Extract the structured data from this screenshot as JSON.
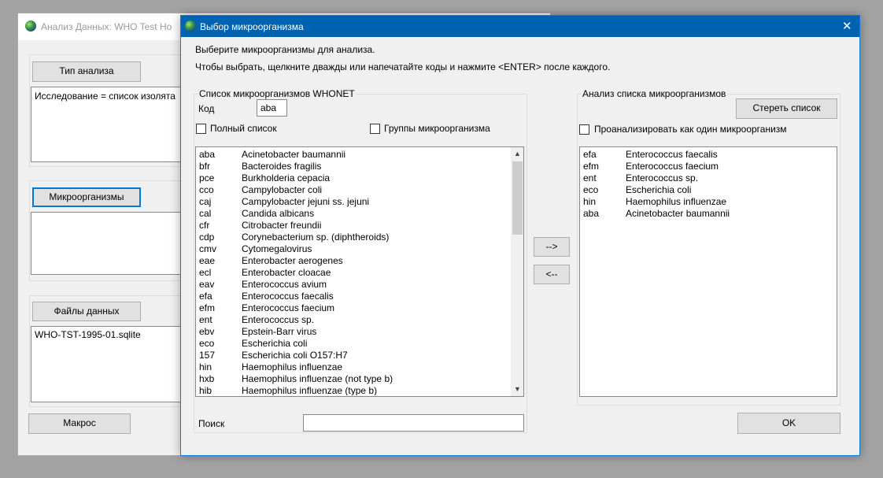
{
  "bg_window": {
    "title": "Анализ Данных: WHO Test Ho",
    "analysis_type_button": "Тип анализа",
    "analysis_text": "Исследование = список изолята",
    "organisms_button": "Микроорганизмы",
    "data_files_button": "Файлы данных",
    "data_file": "WHO-TST-1995-01.sqlite",
    "macro_button": "Макрос"
  },
  "dialog": {
    "title": "Выбор микроорганизма",
    "close_glyph": "✕",
    "instruction_1": "Выберите микроорганизмы для анализа.",
    "instruction_2": "Чтобы выбрать, щелкните дважды или напечатайте коды и нажмите <ENTER> после каждого.",
    "whonet_list": {
      "legend": "Список микроорганизмов WHONET",
      "code_label": "Код",
      "code_value": "aba",
      "full_list_label": "Полный список",
      "groups_label": "Группы микроорганизма",
      "items": [
        {
          "code": "aba",
          "name": "Acinetobacter baumannii"
        },
        {
          "code": "bfr",
          "name": "Bacteroides fragilis"
        },
        {
          "code": "pce",
          "name": "Burkholderia cepacia"
        },
        {
          "code": "cco",
          "name": "Campylobacter coli"
        },
        {
          "code": "caj",
          "name": "Campylobacter jejuni ss. jejuni"
        },
        {
          "code": "cal",
          "name": "Candida albicans"
        },
        {
          "code": "cfr",
          "name": "Citrobacter freundii"
        },
        {
          "code": "cdp",
          "name": "Corynebacterium sp. (diphtheroids)"
        },
        {
          "code": "cmv",
          "name": "Cytomegalovirus"
        },
        {
          "code": "eae",
          "name": "Enterobacter aerogenes"
        },
        {
          "code": "ecl",
          "name": "Enterobacter cloacae"
        },
        {
          "code": "eav",
          "name": "Enterococcus avium"
        },
        {
          "code": "efa",
          "name": "Enterococcus faecalis"
        },
        {
          "code": "efm",
          "name": "Enterococcus faecium"
        },
        {
          "code": "ent",
          "name": "Enterococcus sp."
        },
        {
          "code": "ebv",
          "name": "Epstein-Barr virus"
        },
        {
          "code": "eco",
          "name": "Escherichia coli"
        },
        {
          "code": "157",
          "name": "Escherichia coli O157:H7"
        },
        {
          "code": "hin",
          "name": "Haemophilus influenzae"
        },
        {
          "code": "hxb",
          "name": "Haemophilus influenzae (not type b)"
        },
        {
          "code": "hib",
          "name": "Haemophilus influenzae (type b)"
        }
      ],
      "search_label": "Поиск",
      "search_value": ""
    },
    "add_button": "-->",
    "remove_button": "<--",
    "analysis_list": {
      "legend": "Анализ списка микроорганизмов",
      "clear_button": "Стереть список",
      "single_label": "Проанализировать как один микроорганизм",
      "items": [
        {
          "code": "efa",
          "name": "Enterococcus faecalis"
        },
        {
          "code": "efm",
          "name": "Enterococcus faecium"
        },
        {
          "code": "ent",
          "name": "Enterococcus sp."
        },
        {
          "code": "eco",
          "name": "Escherichia coli"
        },
        {
          "code": "hin",
          "name": "Haemophilus influenzae"
        },
        {
          "code": "aba",
          "name": "Acinetobacter baumannii"
        }
      ]
    },
    "ok_button": "OK"
  }
}
